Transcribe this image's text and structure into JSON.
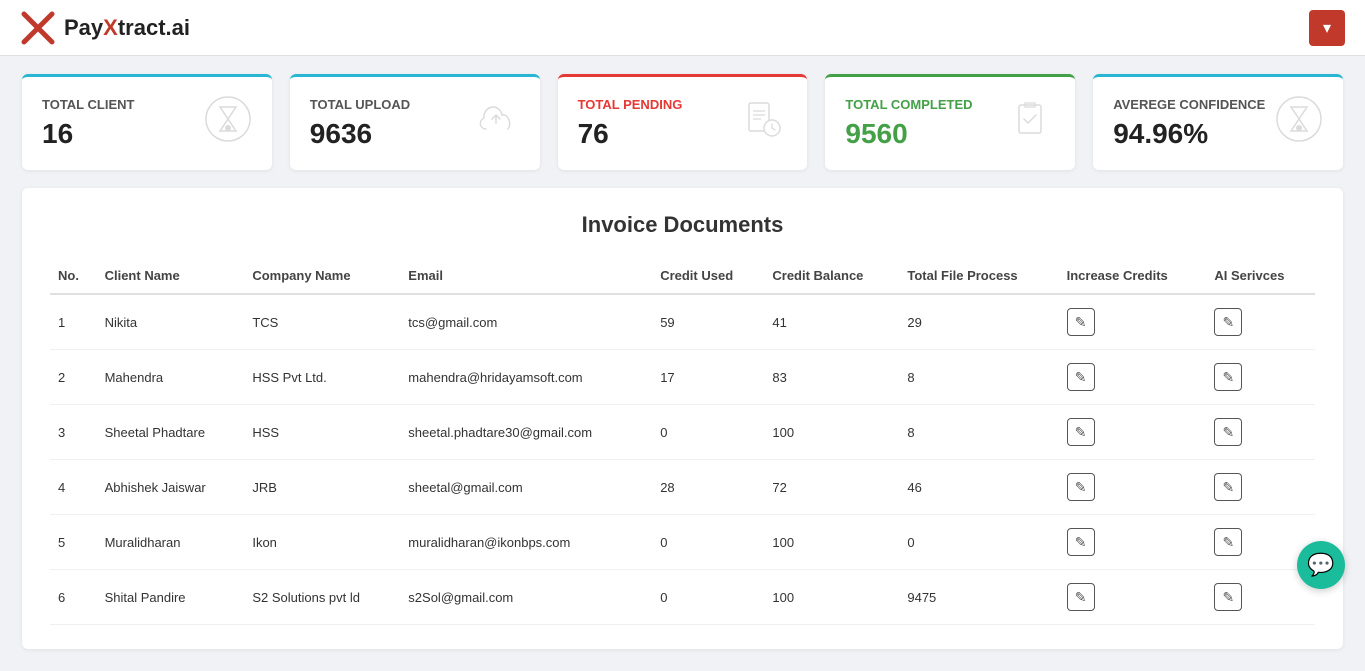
{
  "header": {
    "logo_x": "✕",
    "logo_brand": "PayXtract.ai",
    "dropdown_icon": "▾"
  },
  "stats": [
    {
      "id": "total-client",
      "label": "TOTAL CLIENT",
      "value": "16",
      "icon": "⏱",
      "color": "blue-top",
      "label_color": ""
    },
    {
      "id": "total-upload",
      "label": "TOTAL UPLOAD",
      "value": "9636",
      "icon": "☁",
      "color": "blue-top",
      "label_color": ""
    },
    {
      "id": "total-pending",
      "label": "TOTAL PENDING",
      "value": "76",
      "icon": "🖹",
      "color": "red-top",
      "label_color": "red"
    },
    {
      "id": "total-completed",
      "label": "TOTAL COMPLETED",
      "value": "9560",
      "icon": "📋",
      "color": "green-top",
      "label_color": "green"
    },
    {
      "id": "average-confidence",
      "label": "AVEREGE CONFIDENCE",
      "value": "94.96%",
      "icon": "⏱",
      "color": "blue-top",
      "label_color": ""
    }
  ],
  "table": {
    "title": "Invoice Documents",
    "columns": [
      "No.",
      "Client Name",
      "Company Name",
      "Email",
      "Credit Used",
      "Credit Balance",
      "Total File Process",
      "Increase Credits",
      "AI Serivces"
    ],
    "rows": [
      {
        "no": "1",
        "client": "Nikita",
        "company": "TCS",
        "email": "tcs@gmail.com",
        "credit_used": "59",
        "credit_balance": "41",
        "total_file": "29"
      },
      {
        "no": "2",
        "client": "Mahendra",
        "company": "HSS Pvt Ltd.",
        "email": "mahendra@hridayamsoft.com",
        "credit_used": "17",
        "credit_balance": "83",
        "total_file": "8"
      },
      {
        "no": "3",
        "client": "Sheetal Phadtare",
        "company": "HSS",
        "email": "sheetal.phadtare30@gmail.com",
        "credit_used": "0",
        "credit_balance": "100",
        "total_file": "8"
      },
      {
        "no": "4",
        "client": "Abhishek Jaiswar",
        "company": "JRB",
        "email": "sheetal@gmail.com",
        "credit_used": "28",
        "credit_balance": "72",
        "total_file": "46"
      },
      {
        "no": "5",
        "client": "Muralidharan",
        "company": "Ikon",
        "email": "muralidharan@ikonbps.com",
        "credit_used": "0",
        "credit_balance": "100",
        "total_file": "0"
      },
      {
        "no": "6",
        "client": "Shital Pandire",
        "company": "S2 Solutions pvt ld",
        "email": "s2Sol@gmail.com",
        "credit_used": "0",
        "credit_balance": "100",
        "total_file": "9475"
      }
    ]
  }
}
